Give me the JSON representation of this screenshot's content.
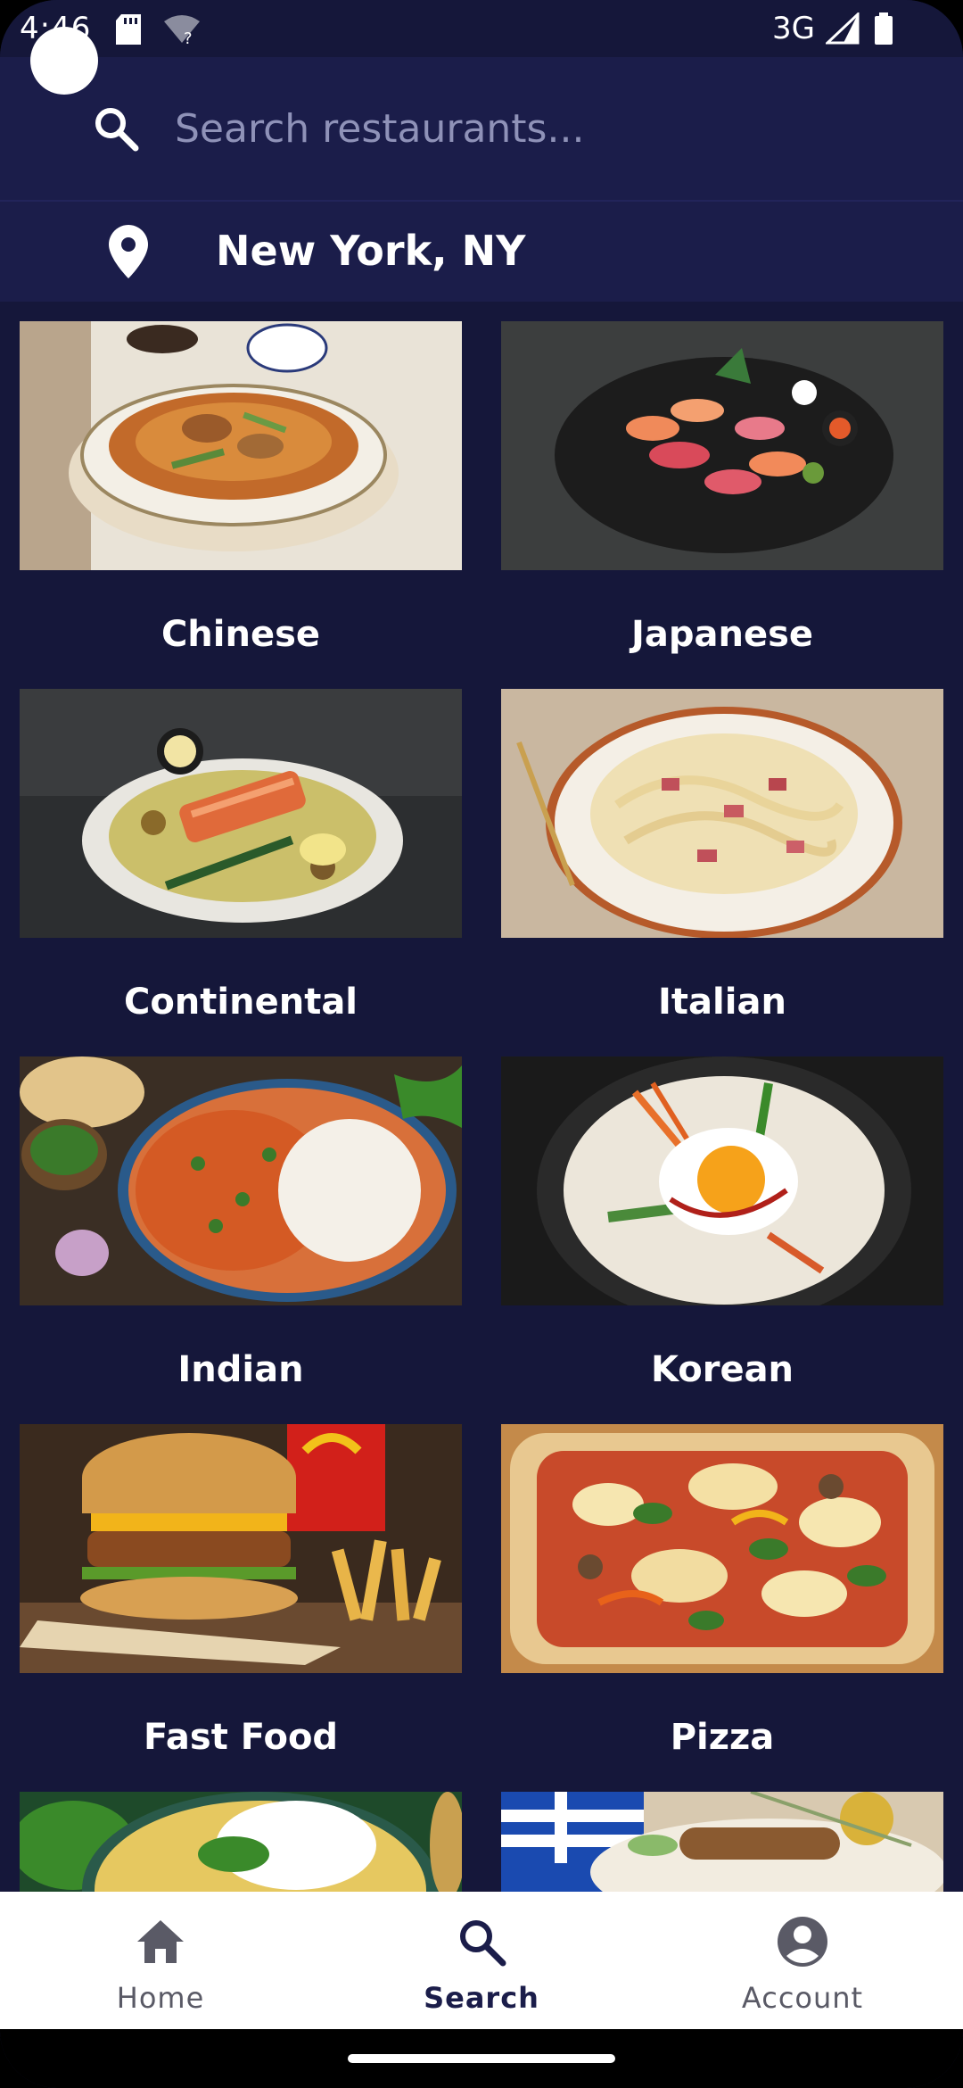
{
  "status_bar": {
    "time": "4:46",
    "network": "3G",
    "icons": [
      "sd-card-icon",
      "wifi-unknown-icon",
      "signal-icon",
      "battery-icon"
    ]
  },
  "search": {
    "placeholder": "Search restaurants...",
    "value": "",
    "icon": "search-icon"
  },
  "location": {
    "text": "New York, NY",
    "icon": "location-pin-icon"
  },
  "categories": [
    {
      "label": "Chinese"
    },
    {
      "label": "Japanese"
    },
    {
      "label": "Continental"
    },
    {
      "label": "Italian"
    },
    {
      "label": "Indian"
    },
    {
      "label": "Korean"
    },
    {
      "label": "Fast Food"
    },
    {
      "label": "Pizza"
    },
    {
      "label": ""
    },
    {
      "label": ""
    }
  ],
  "bottom_nav": {
    "items": [
      {
        "label": "Home",
        "icon": "home-icon"
      },
      {
        "label": "Search",
        "icon": "search-icon",
        "active": true
      },
      {
        "label": "Account",
        "icon": "account-icon"
      }
    ]
  },
  "colors": {
    "background": "#15173a",
    "header": "#1b1d4a",
    "nav_background": "#ffffff",
    "nav_active": "#1b1d4a",
    "nav_inactive": "#5a5a66"
  }
}
